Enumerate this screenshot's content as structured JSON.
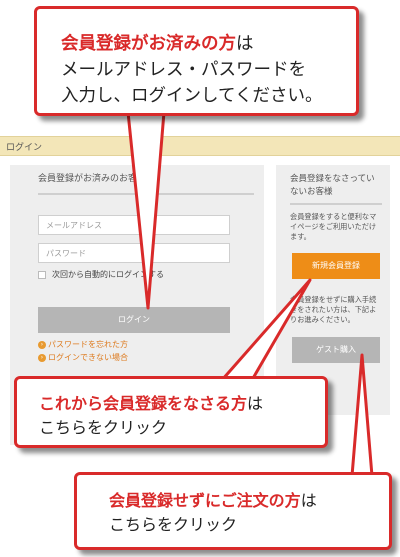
{
  "titlebar": {
    "label": "ログイン"
  },
  "login": {
    "heading": "会員登録がお済みのお客様",
    "email_placeholder": "メールアドレス",
    "password_placeholder": "パスワード",
    "remember_label": "次回から自動的にログインする",
    "login_button": "ログイン",
    "forgot_password_link": "パスワードを忘れた方",
    "cannot_login_link": "ログインできない場合"
  },
  "register": {
    "heading": "会員登録をなさっていないお客様",
    "description": "会員登録をすると便利なマイページをご利用いただけます。",
    "new_member_button": "新規会員登録",
    "guest_description": "会員登録をせずに購入手続きをされたい方は、下記よりお進みください。",
    "guest_button": "ゲスト購入"
  },
  "callouts": {
    "top": {
      "em": "会員登録がお済みの方",
      "rest": "は",
      "line2": "メールアドレス・パスワードを",
      "line3": "入力し、ログインしてください。"
    },
    "middle": {
      "em": "これから会員登録をなさる方",
      "rest": "は",
      "line2": "こちらをクリック"
    },
    "bottom": {
      "em": "会員登録せずにご注文の方",
      "rest": "は",
      "line2": "こちらをクリック"
    }
  },
  "colors": {
    "accent_red": "#d92a2a",
    "orange": "#ee8d17",
    "panel": "#eeeeee",
    "titlebar": "#f3e6b8"
  }
}
